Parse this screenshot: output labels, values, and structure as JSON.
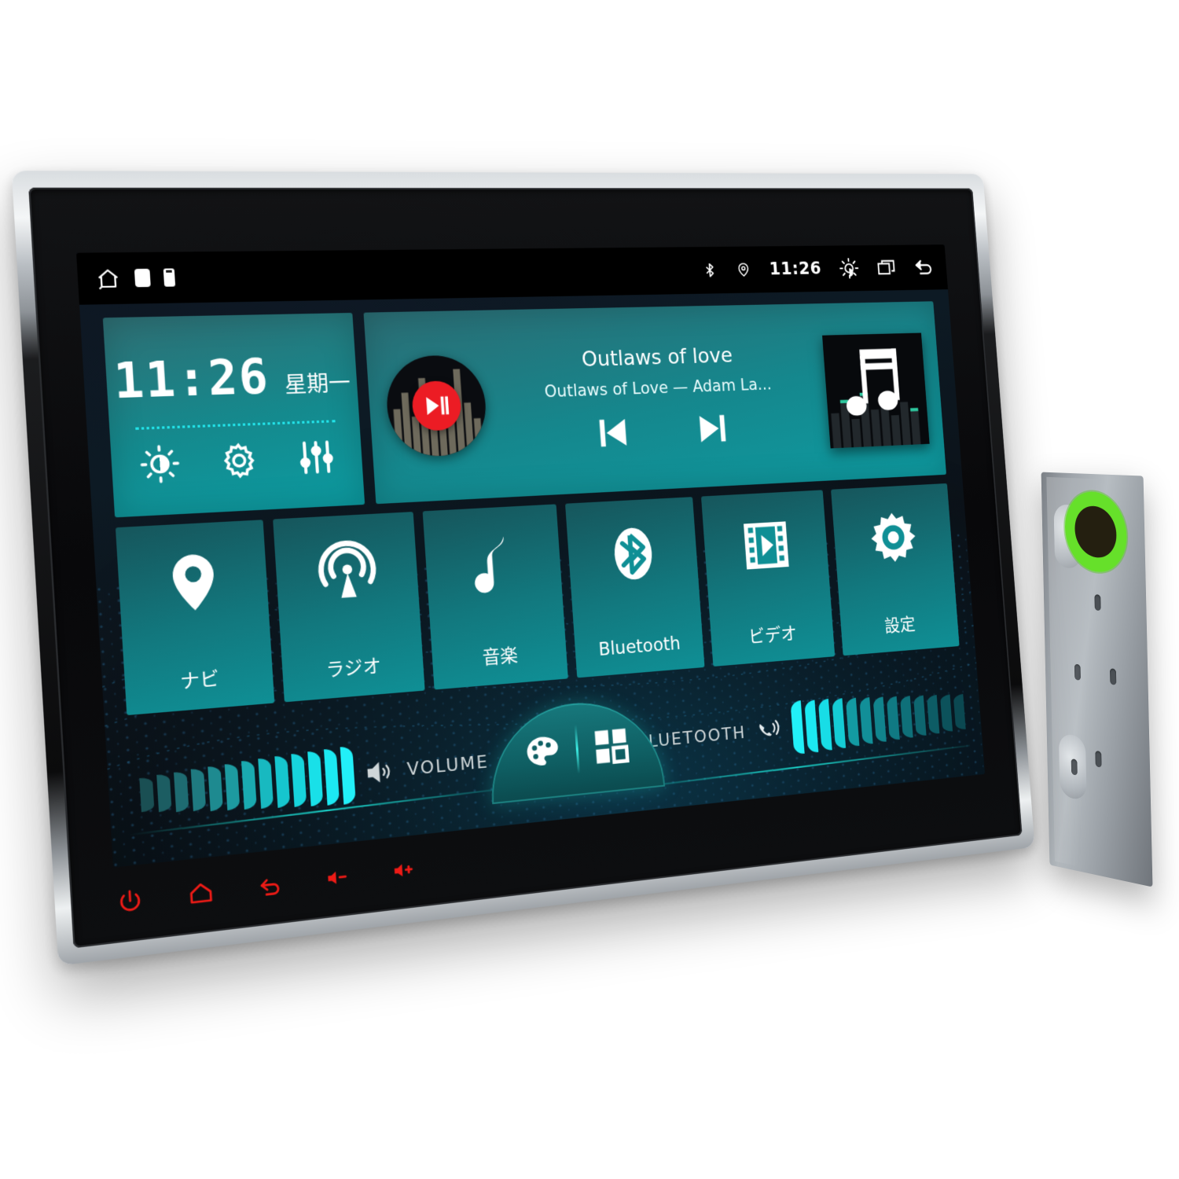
{
  "device": {
    "name": "car-head-unit",
    "hardware_keys": [
      {
        "icon": "power-icon",
        "name": "power"
      },
      {
        "icon": "home-icon",
        "name": "home"
      },
      {
        "icon": "back-icon",
        "name": "back"
      },
      {
        "icon": "volume-down-icon",
        "name": "volume-down"
      },
      {
        "icon": "volume-up-icon",
        "name": "volume-up"
      }
    ],
    "key_color": "#ee1b16"
  },
  "statusbar": {
    "home_icon": "home-icon",
    "page_indicator_1": "page-dot",
    "page_indicator_2": "page-dot-secondary",
    "bluetooth_icon": "bluetooth-icon",
    "location_icon": "location-pin-icon",
    "time": "11:26",
    "brightness_icon": "brightness-icon",
    "recents_icon": "recent-apps-icon",
    "back_icon": "back-arrow-icon"
  },
  "clock_widget": {
    "time": "11:26",
    "weekday": "星期一",
    "shortcuts": [
      {
        "icon": "brightness-icon",
        "label": "brightness"
      },
      {
        "icon": "gear-icon",
        "label": "settings"
      },
      {
        "icon": "equalizer-icon",
        "label": "equalizer"
      }
    ]
  },
  "music_widget": {
    "title": "Outlaws of love",
    "subtitle": "Outlaws of Love — Adam La...",
    "play_icon": "play-pause-icon",
    "prev_icon": "previous-track-icon",
    "next_icon": "next-track-icon",
    "album_art_icon": "music-note-icon",
    "play_button_color": "#ec1c24"
  },
  "apps": [
    {
      "label": "ナビ",
      "icon": "map-pin-icon"
    },
    {
      "label": "ラジオ",
      "icon": "radio-antenna-icon"
    },
    {
      "label": "音楽",
      "icon": "music-note-icon"
    },
    {
      "label": "Bluetooth",
      "icon": "bluetooth-icon"
    },
    {
      "label": "ビデオ",
      "icon": "film-play-icon"
    },
    {
      "label": "設定",
      "icon": "gear-icon"
    }
  ],
  "bottom_bar": {
    "volume_label": "VOLUME",
    "volume_icon": "speaker-icon",
    "volume_segments_total": 13,
    "volume_segments_active": 13,
    "bluetooth_label": "BLUETOOTH",
    "bluetooth_icon": "phone-call-icon",
    "bluetooth_segments_total": 13,
    "bluetooth_segments_active": 4,
    "dock": [
      {
        "icon": "palette-icon",
        "label": "theme"
      },
      {
        "icon": "apps-grid-icon",
        "label": "all-apps"
      }
    ]
  },
  "theme": {
    "accent": "#17cfc8",
    "tile_teal": "#0f9aa0",
    "screen_dark": "#0b1016"
  }
}
